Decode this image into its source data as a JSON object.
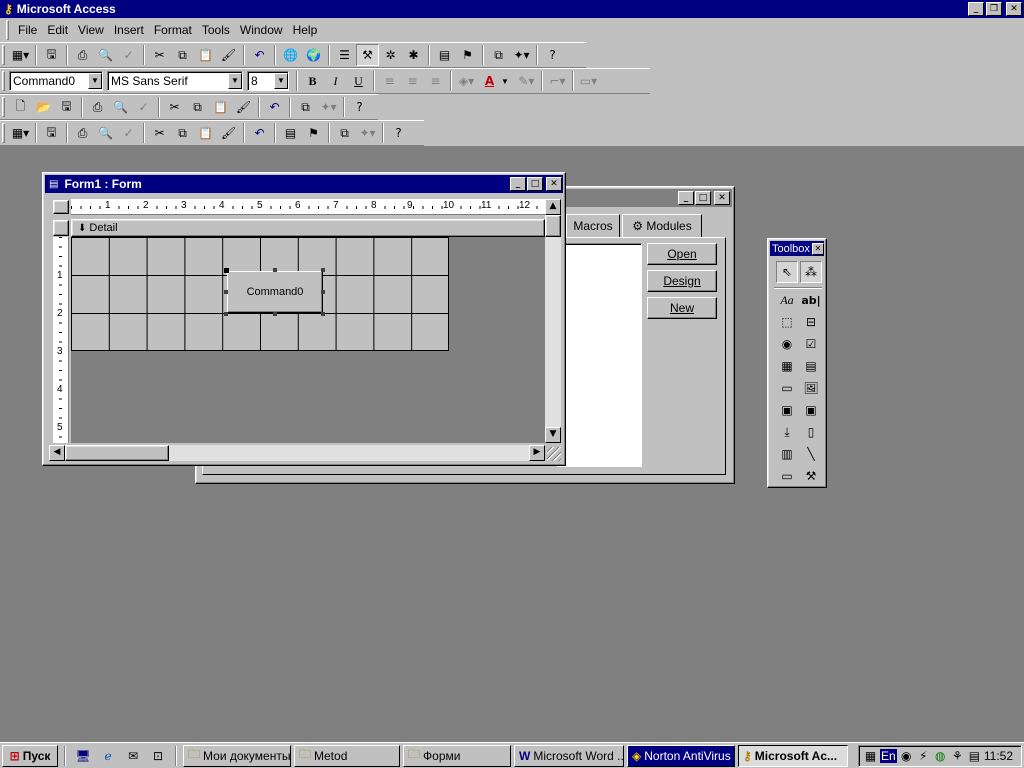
{
  "app": {
    "title": "Microsoft Access"
  },
  "menu": [
    "File",
    "Edit",
    "View",
    "Insert",
    "Format",
    "Tools",
    "Window",
    "Help"
  ],
  "format_bar": {
    "control": "Command0",
    "font": "MS Sans Serif",
    "size": "8",
    "bold": "B",
    "italic": "I",
    "underline": "U"
  },
  "form_window": {
    "title": "Form1 : Form",
    "section": "Detail",
    "ruler_h": [
      "1",
      "2",
      "3",
      "4",
      "5",
      "6",
      "7",
      "8",
      "9",
      "10",
      "11",
      "12"
    ],
    "ruler_v": [
      "1",
      "2",
      "3",
      "4",
      "5"
    ],
    "command_button": "Command0"
  },
  "db_window": {
    "tabs": [
      "Macros",
      "Modules"
    ],
    "buttons": [
      "Open",
      "Design",
      "New"
    ]
  },
  "toolbox": {
    "title": "Toolbox"
  },
  "taskbar": {
    "start": "Пуск",
    "tasks": [
      "Мои документы",
      "Metod",
      "Форми",
      "Microsoft Word ...",
      "Norton AntiVirus",
      "Microsoft Ac..."
    ],
    "lang": "En",
    "clock": "11:52"
  },
  "colors": {
    "desktop": "#808080",
    "titlebar": "#000080",
    "face": "#c0c0c0"
  }
}
